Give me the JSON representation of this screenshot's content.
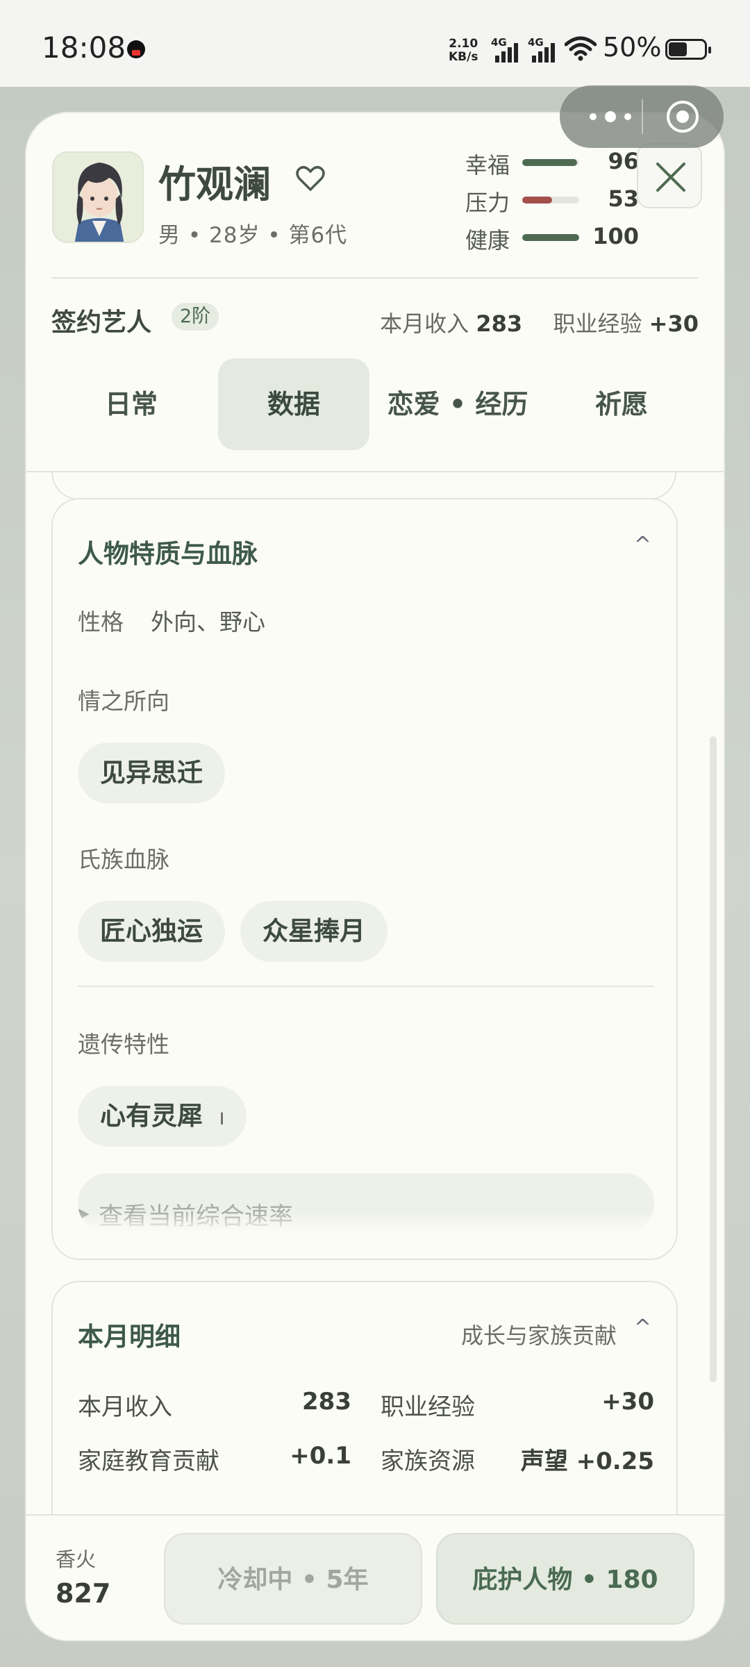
{
  "status_bar": {
    "time": "18:08",
    "net_speed_value": "2.10",
    "net_speed_unit": "KB/s",
    "signal_1_label": "4G",
    "signal_2_label": "4G",
    "battery": "50%"
  },
  "profile": {
    "name": "竹观澜",
    "gender": "男",
    "age": "28岁",
    "generation": "第6代",
    "stats": [
      {
        "label": "幸福",
        "value": "96",
        "level": 0.96,
        "color": "#4e6b52"
      },
      {
        "label": "压力",
        "value": "53",
        "level": 0.53,
        "color": "#a3504a"
      },
      {
        "label": "健康",
        "value": "100",
        "level": 1.0,
        "color": "#4e6b52"
      }
    ]
  },
  "career": {
    "role": "签约艺人",
    "rank": "2阶",
    "income_label": "本月收入",
    "income_value": "283",
    "exp_label": "职业经验",
    "exp_value": "+30"
  },
  "tabs": [
    {
      "label": "日常"
    },
    {
      "label": "数据"
    },
    {
      "label": "恋爱 • 经历"
    },
    {
      "label": "祈愿"
    }
  ],
  "traits_section": {
    "title": "人物特质与血脉",
    "collapse_glyph": "^",
    "personality_label": "性格",
    "personality_value": "外向、野心",
    "love_label": "情之所向",
    "love_chips": [
      "见异思迁"
    ],
    "clan_label": "氏族血脉",
    "clan_chips": [
      "匠心独运",
      "众星捧月"
    ],
    "hereditary_label": "遗传特性",
    "hereditary_chip": "心有灵犀",
    "hereditary_tier": "I",
    "rate_button": "查看当前综合速率"
  },
  "monthly_section": {
    "title": "本月明细",
    "subtitle": "成长与家族贡献",
    "collapse_glyph": "^",
    "rows": [
      {
        "k1": "本月收入",
        "v1": "283",
        "k2": "职业经验",
        "v2": "+30"
      },
      {
        "k1": "家庭教育贡献",
        "v1": "+0.1",
        "k2": "家族资源",
        "v2": "声望 +0.25"
      }
    ]
  },
  "footer": {
    "incense_label": "香火",
    "incense_value": "827",
    "cooldown_button": "冷却中 • 5年",
    "protect_button": "庇护人物 • 180"
  },
  "colors": {
    "accent": "#4e6b52",
    "stress": "#a3504a",
    "card_bg": "#fcfcf7"
  }
}
